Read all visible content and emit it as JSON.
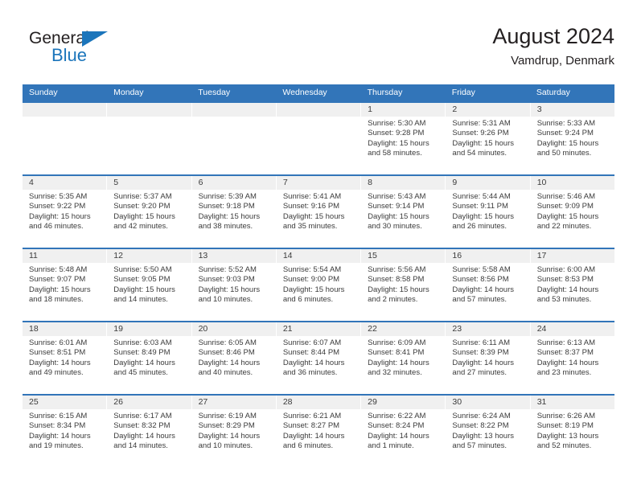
{
  "brand": {
    "name_dark": "General",
    "name_blue": "Blue",
    "accent_color": "#1b75bb"
  },
  "header": {
    "title": "August 2024",
    "subtitle": "Vamdrup, Denmark"
  },
  "theme": {
    "header_row_color": "#3275b9",
    "day_band_color": "#f0f0f0",
    "text_color": "#3b3b3b"
  },
  "weekdays": [
    "Sunday",
    "Monday",
    "Tuesday",
    "Wednesday",
    "Thursday",
    "Friday",
    "Saturday"
  ],
  "weeks": [
    [
      {
        "day": "",
        "empty": true,
        "lines": []
      },
      {
        "day": "",
        "empty": true,
        "lines": []
      },
      {
        "day": "",
        "empty": true,
        "lines": []
      },
      {
        "day": "",
        "empty": true,
        "lines": []
      },
      {
        "day": "1",
        "lines": [
          "Sunrise: 5:30 AM",
          "Sunset: 9:28 PM",
          "Daylight: 15 hours",
          "and 58 minutes."
        ]
      },
      {
        "day": "2",
        "lines": [
          "Sunrise: 5:31 AM",
          "Sunset: 9:26 PM",
          "Daylight: 15 hours",
          "and 54 minutes."
        ]
      },
      {
        "day": "3",
        "lines": [
          "Sunrise: 5:33 AM",
          "Sunset: 9:24 PM",
          "Daylight: 15 hours",
          "and 50 minutes."
        ]
      }
    ],
    [
      {
        "day": "4",
        "lines": [
          "Sunrise: 5:35 AM",
          "Sunset: 9:22 PM",
          "Daylight: 15 hours",
          "and 46 minutes."
        ]
      },
      {
        "day": "5",
        "lines": [
          "Sunrise: 5:37 AM",
          "Sunset: 9:20 PM",
          "Daylight: 15 hours",
          "and 42 minutes."
        ]
      },
      {
        "day": "6",
        "lines": [
          "Sunrise: 5:39 AM",
          "Sunset: 9:18 PM",
          "Daylight: 15 hours",
          "and 38 minutes."
        ]
      },
      {
        "day": "7",
        "lines": [
          "Sunrise: 5:41 AM",
          "Sunset: 9:16 PM",
          "Daylight: 15 hours",
          "and 35 minutes."
        ]
      },
      {
        "day": "8",
        "lines": [
          "Sunrise: 5:43 AM",
          "Sunset: 9:14 PM",
          "Daylight: 15 hours",
          "and 30 minutes."
        ]
      },
      {
        "day": "9",
        "lines": [
          "Sunrise: 5:44 AM",
          "Sunset: 9:11 PM",
          "Daylight: 15 hours",
          "and 26 minutes."
        ]
      },
      {
        "day": "10",
        "lines": [
          "Sunrise: 5:46 AM",
          "Sunset: 9:09 PM",
          "Daylight: 15 hours",
          "and 22 minutes."
        ]
      }
    ],
    [
      {
        "day": "11",
        "lines": [
          "Sunrise: 5:48 AM",
          "Sunset: 9:07 PM",
          "Daylight: 15 hours",
          "and 18 minutes."
        ]
      },
      {
        "day": "12",
        "lines": [
          "Sunrise: 5:50 AM",
          "Sunset: 9:05 PM",
          "Daylight: 15 hours",
          "and 14 minutes."
        ]
      },
      {
        "day": "13",
        "lines": [
          "Sunrise: 5:52 AM",
          "Sunset: 9:03 PM",
          "Daylight: 15 hours",
          "and 10 minutes."
        ]
      },
      {
        "day": "14",
        "lines": [
          "Sunrise: 5:54 AM",
          "Sunset: 9:00 PM",
          "Daylight: 15 hours",
          "and 6 minutes."
        ]
      },
      {
        "day": "15",
        "lines": [
          "Sunrise: 5:56 AM",
          "Sunset: 8:58 PM",
          "Daylight: 15 hours",
          "and 2 minutes."
        ]
      },
      {
        "day": "16",
        "lines": [
          "Sunrise: 5:58 AM",
          "Sunset: 8:56 PM",
          "Daylight: 14 hours",
          "and 57 minutes."
        ]
      },
      {
        "day": "17",
        "lines": [
          "Sunrise: 6:00 AM",
          "Sunset: 8:53 PM",
          "Daylight: 14 hours",
          "and 53 minutes."
        ]
      }
    ],
    [
      {
        "day": "18",
        "lines": [
          "Sunrise: 6:01 AM",
          "Sunset: 8:51 PM",
          "Daylight: 14 hours",
          "and 49 minutes."
        ]
      },
      {
        "day": "19",
        "lines": [
          "Sunrise: 6:03 AM",
          "Sunset: 8:49 PM",
          "Daylight: 14 hours",
          "and 45 minutes."
        ]
      },
      {
        "day": "20",
        "lines": [
          "Sunrise: 6:05 AM",
          "Sunset: 8:46 PM",
          "Daylight: 14 hours",
          "and 40 minutes."
        ]
      },
      {
        "day": "21",
        "lines": [
          "Sunrise: 6:07 AM",
          "Sunset: 8:44 PM",
          "Daylight: 14 hours",
          "and 36 minutes."
        ]
      },
      {
        "day": "22",
        "lines": [
          "Sunrise: 6:09 AM",
          "Sunset: 8:41 PM",
          "Daylight: 14 hours",
          "and 32 minutes."
        ]
      },
      {
        "day": "23",
        "lines": [
          "Sunrise: 6:11 AM",
          "Sunset: 8:39 PM",
          "Daylight: 14 hours",
          "and 27 minutes."
        ]
      },
      {
        "day": "24",
        "lines": [
          "Sunrise: 6:13 AM",
          "Sunset: 8:37 PM",
          "Daylight: 14 hours",
          "and 23 minutes."
        ]
      }
    ],
    [
      {
        "day": "25",
        "lines": [
          "Sunrise: 6:15 AM",
          "Sunset: 8:34 PM",
          "Daylight: 14 hours",
          "and 19 minutes."
        ]
      },
      {
        "day": "26",
        "lines": [
          "Sunrise: 6:17 AM",
          "Sunset: 8:32 PM",
          "Daylight: 14 hours",
          "and 14 minutes."
        ]
      },
      {
        "day": "27",
        "lines": [
          "Sunrise: 6:19 AM",
          "Sunset: 8:29 PM",
          "Daylight: 14 hours",
          "and 10 minutes."
        ]
      },
      {
        "day": "28",
        "lines": [
          "Sunrise: 6:21 AM",
          "Sunset: 8:27 PM",
          "Daylight: 14 hours",
          "and 6 minutes."
        ]
      },
      {
        "day": "29",
        "lines": [
          "Sunrise: 6:22 AM",
          "Sunset: 8:24 PM",
          "Daylight: 14 hours",
          "and 1 minute."
        ]
      },
      {
        "day": "30",
        "lines": [
          "Sunrise: 6:24 AM",
          "Sunset: 8:22 PM",
          "Daylight: 13 hours",
          "and 57 minutes."
        ]
      },
      {
        "day": "31",
        "lines": [
          "Sunrise: 6:26 AM",
          "Sunset: 8:19 PM",
          "Daylight: 13 hours",
          "and 52 minutes."
        ]
      }
    ]
  ]
}
